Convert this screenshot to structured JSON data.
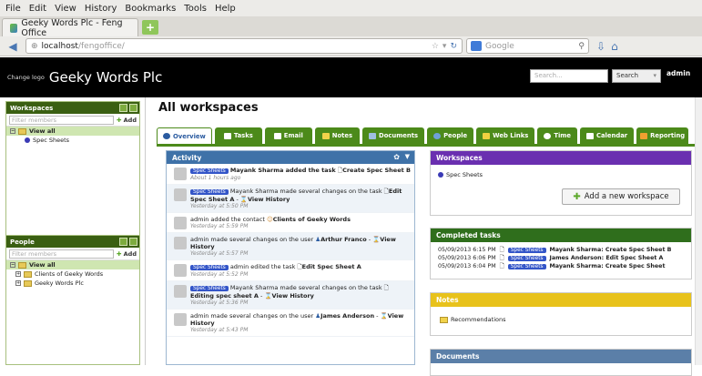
{
  "browser": {
    "menu": [
      "File",
      "Edit",
      "View",
      "History",
      "Bookmarks",
      "Tools",
      "Help"
    ],
    "tab_title": "Geeky Words Plc - Feng Office",
    "url_host": "localhost",
    "url_path": "/fengoffice/",
    "search_engine": "Google"
  },
  "header": {
    "change_logo": "Change logo",
    "app_name": "Geeky Words Plc",
    "search_placeholder": "Search...",
    "search_button": "Search",
    "user": "admin"
  },
  "sidebar": {
    "workspaces": {
      "title": "Workspaces",
      "filter_placeholder": "Filter members",
      "add_label": "Add",
      "view_all": "View all",
      "items": [
        "Spec Sheets"
      ]
    },
    "people": {
      "title": "People",
      "filter_placeholder": "Filter members",
      "add_label": "Add",
      "view_all": "View all",
      "items": [
        "Clients of Geeky Words",
        "Geeky Words Plc"
      ]
    }
  },
  "main": {
    "title": "All workspaces",
    "tabs": [
      "Overview",
      "Tasks",
      "Email",
      "Notes",
      "Documents",
      "People",
      "Web Links",
      "Time",
      "Calendar",
      "Reporting"
    ],
    "activity": {
      "title": "Activity",
      "items": [
        {
          "tag": "Spec Sheets",
          "text": "Mayank Sharma added the task",
          "link": "Create Spec Sheet B",
          "time": "About 1 hours ago"
        },
        {
          "tag": "Spec Sheets",
          "text": "Mayank Sharma made several changes on the task",
          "link": "Edit Spec Sheet A",
          "extra": "View History",
          "time": "Yesterday at 5:50 PM"
        },
        {
          "tag": "",
          "text": "admin added the contact",
          "link": "Clients of Geeky Words",
          "time": "Yesterday at 5:59 PM"
        },
        {
          "tag": "",
          "text": "admin made several changes on the user",
          "link": "Arthur Franco",
          "extra": "View History",
          "time": "Yesterday at 5:57 PM"
        },
        {
          "tag": "Spec Sheets",
          "text": "admin edited the task",
          "link": "Edit Spec Sheet A",
          "time": "Yesterday at 5:52 PM"
        },
        {
          "tag": "Spec Sheets",
          "text": "Mayank Sharma made several changes on the task",
          "link": "Editing spec sheet A",
          "extra": "View History",
          "time": "Yesterday at 5:36 PM"
        },
        {
          "tag": "",
          "text": "admin made several changes on the user",
          "link": "James Anderson",
          "extra": "View History",
          "time": "Yesterday at 5:43 PM"
        }
      ]
    },
    "workspaces_box": {
      "title": "Workspaces",
      "items": [
        "Spec Sheets"
      ],
      "add_button": "Add a new workspace"
    },
    "completed_tasks": {
      "title": "Completed tasks",
      "rows": [
        {
          "date": "05/09/2013 6:15 PM",
          "tag": "Spec Sheets",
          "text": "Mayank Sharma: Create Spec Sheet B"
        },
        {
          "date": "05/09/2013 6:06 PM",
          "tag": "Spec Sheets",
          "text": "James Anderson: Edit Spec Sheet A"
        },
        {
          "date": "05/09/2013 6:04 PM",
          "tag": "Spec Sheets",
          "text": "Mayank Sharma: Create Spec Sheet"
        }
      ]
    },
    "notes_box": {
      "title": "Notes",
      "items": [
        "Recommendations"
      ]
    },
    "documents_box": {
      "title": "Documents"
    }
  },
  "colors": {
    "header_bg": "#000000",
    "panel_green": "#3a5f12",
    "tab_green": "#4c8a1a",
    "activity_blue": "#3f72a8",
    "workspaces_purple": "#6a2fb0",
    "tasks_green": "#2f6e1c",
    "notes_yellow": "#e8c21b",
    "docs_blue": "#5b7fa8",
    "tag_blue": "#3355c8"
  }
}
